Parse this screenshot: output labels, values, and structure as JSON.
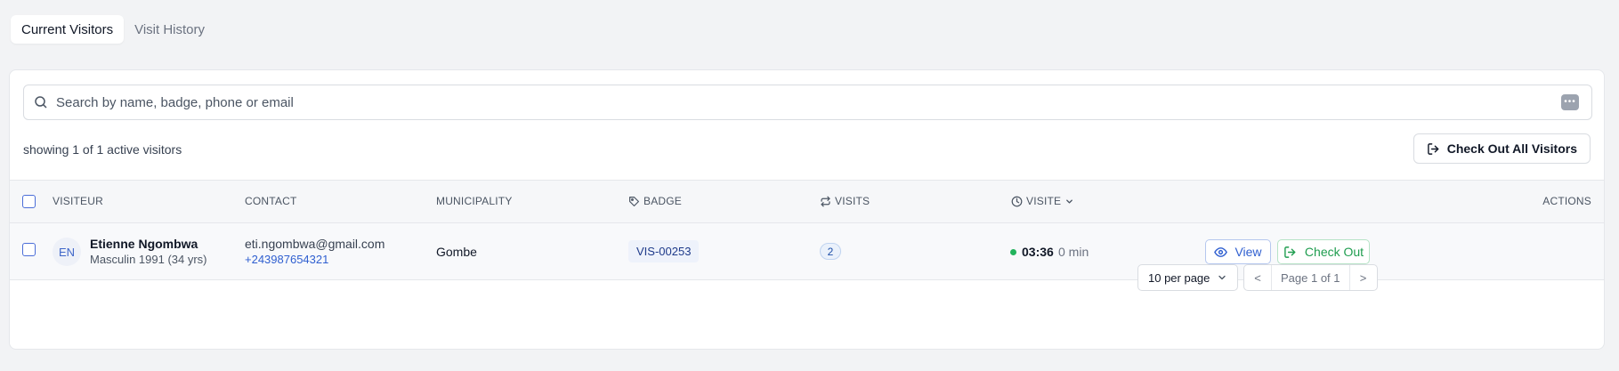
{
  "tabs": [
    {
      "label": "Current Visitors",
      "active": true
    },
    {
      "label": "Visit History",
      "active": false
    }
  ],
  "search": {
    "placeholder": "Search by name, badge, phone or email",
    "value": "",
    "icon": "search-icon",
    "more_icon": "more-horizontal-icon",
    "more_label": "•••"
  },
  "summary": {
    "showing": "showing 1 of 1 active visitors"
  },
  "toolbar": {
    "checkout_all_label": "Check Out All Visitors",
    "checkout_all_icon": "log-out-icon"
  },
  "table": {
    "columns": {
      "visitor": "VISITEUR",
      "contact": "CONTACT",
      "municipality": "MUNICIPALITY",
      "badge": "BADGE",
      "visits": "VISITS",
      "visit": "VISITE",
      "actions": "ACTIONS"
    },
    "rows": [
      {
        "initials": "EN",
        "name": "Etienne Ngombwa",
        "details": "Masculin 1991 (34 yrs)",
        "email": "eti.ngombwa@gmail.com",
        "phone": "+243987654321",
        "municipality": "Gombe",
        "badge": "VIS-00253",
        "visits": "2",
        "time": "03:36",
        "duration": "0 min",
        "view_label": "View",
        "checkout_label": "Check Out"
      }
    ]
  },
  "pagination": {
    "per_page": "10 per page",
    "prev": "<",
    "next": ">",
    "page_label": "Page 1 of 1"
  },
  "colors": {
    "accent": "#2f5fd0",
    "success": "#1f9d4f",
    "status_dot": "#22b35c",
    "background": "#f2f3f5"
  }
}
